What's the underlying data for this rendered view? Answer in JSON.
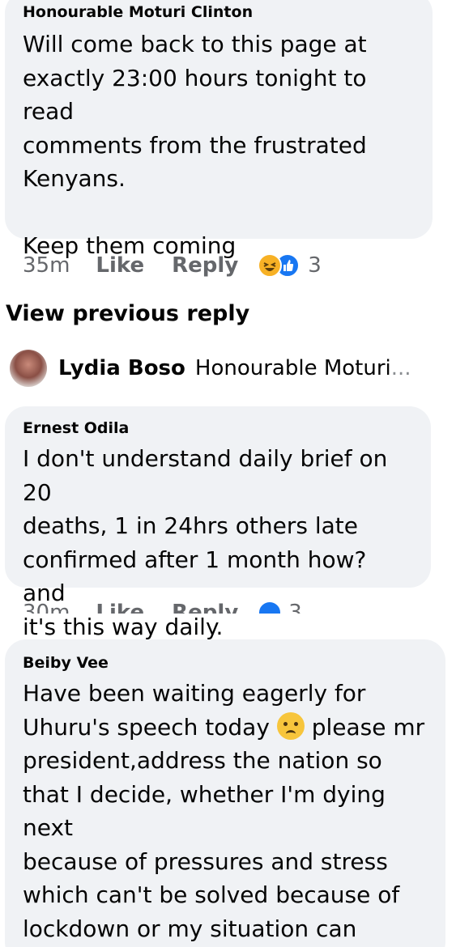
{
  "comments": [
    {
      "author": "Honourable Moturi Clinton",
      "text": "Will come back to this page at\nexactly 23:00 hours tonight to read\ncomments from the frustrated\nKenyans.\n\nKeep them coming",
      "time": "35m",
      "like_label": "Like",
      "reply_label": "Reply",
      "reaction_icons": [
        "haha-icon",
        "like-icon"
      ],
      "reaction_count": "3"
    },
    {
      "author": "Ernest Odila",
      "text": "I don't understand daily brief on 20\ndeaths, 1 in 24hrs others late\nconfirmed after 1 month how? and\nit's this way daily.",
      "time": "30m",
      "like_label": "Like",
      "reply_label": "Reply",
      "reaction_icons": [
        "like-icon"
      ],
      "reaction_count": "3"
    },
    {
      "author": "Beiby Vee",
      "text_before_emoji": "Have been waiting eagerly for\nUhuru's speech today ",
      "emoji": "crying-face-icon",
      "text_after_emoji": " please mr\npresident,address the nation so\nthat I decide, whether I'm dying next\nbecause of pressures and stress\nwhich can't be solved because of\nlockdown or my situation can\nchange"
    }
  ],
  "view_previous_reply": "View previous reply",
  "reply_preview": {
    "author": "Lydia Boso",
    "snippet": "Honourable Moturi",
    "ellipsis": "..."
  },
  "colors": {
    "bubble": "#f0f2f5",
    "meta_text": "#65676b",
    "like_blue": "#1877f2",
    "haha_yellow": "#f7b125"
  }
}
